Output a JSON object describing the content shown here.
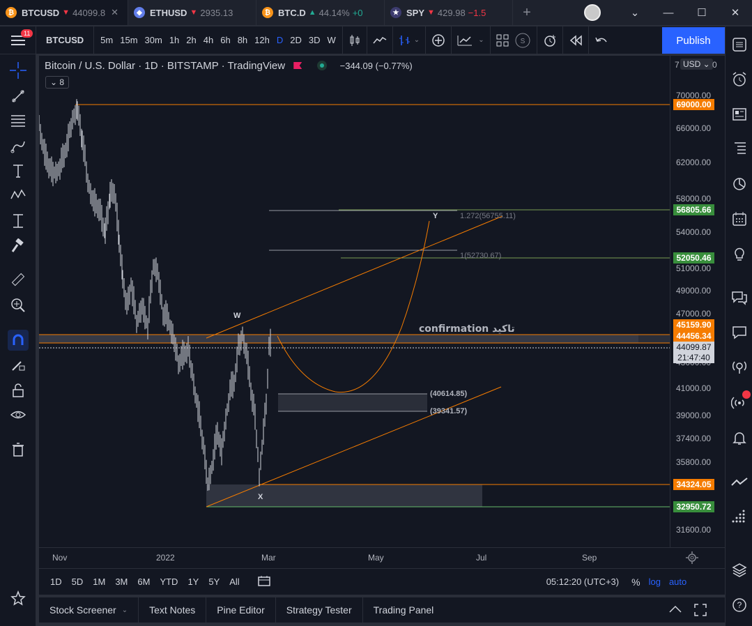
{
  "browser_tabs": [
    {
      "symbol": "BTCUSD",
      "arrow": "▼",
      "price": "44099.8",
      "icon_color": "#f7931a",
      "icon_glyph": "₿",
      "active": true
    },
    {
      "symbol": "ETHUSD",
      "arrow": "▼",
      "price": "2935.13",
      "icon_color": "#627eea",
      "icon_glyph": "◆",
      "active": false
    },
    {
      "symbol": "BTC.D",
      "arrow": "▲",
      "price": "44.14%",
      "extra": "+0",
      "icon_color": "#f7931a",
      "icon_glyph": "₿",
      "active": false
    },
    {
      "symbol": "SPY",
      "arrow": "▼",
      "price": "429.98",
      "extra": "−1.5",
      "icon_color": "#3c3b6e",
      "icon_glyph": "★",
      "active": false
    }
  ],
  "toolbar": {
    "notification_count": "11",
    "symbol": "BTCUSD",
    "intervals": [
      "5m",
      "15m",
      "30m",
      "1h",
      "2h",
      "4h",
      "6h",
      "8h",
      "12h",
      "D",
      "2D",
      "3D",
      "W"
    ],
    "selected_interval": "D",
    "publish_label": "Publish"
  },
  "legend": {
    "title": "Bitcoin / U.S. Dollar · 1D · BITSTAMP · TradingView",
    "change": "−344.09 (−0.77%)",
    "indicator_count": "8"
  },
  "price_scale": {
    "currency": "USD",
    "top_digit": "7",
    "top_digit_2": "0",
    "ticks": [
      "70000.00",
      "66000.00",
      "62000.00",
      "58000.00",
      "54000.00",
      "51000.00",
      "49000.00",
      "47000.00",
      "43000.00",
      "41000.00",
      "39000.00",
      "37400.00",
      "35800.00",
      "31600.00"
    ],
    "tags": [
      {
        "label": "69000.00",
        "color": "#f57c00"
      },
      {
        "label": "56805.66",
        "color": "#388e3c"
      },
      {
        "label": "52050.46",
        "color": "#388e3c"
      },
      {
        "label": "45159.90",
        "color": "#f57c00"
      },
      {
        "label": "44456.34",
        "color": "#f57c00"
      },
      {
        "label": "34324.05",
        "color": "#f57c00"
      },
      {
        "label": "32950.72",
        "color": "#388e3c"
      }
    ],
    "last_price": "44099.87",
    "countdown": "21:47:40"
  },
  "annotations": {
    "w_label": "W",
    "x_label": "X",
    "y_label": "Y",
    "confirmation": "confirmation تاکید",
    "fib_1272": "1.272(56755.11)",
    "fib_1": "1(52730.67)",
    "box_top": "(40614.85)",
    "box_bottom": "(39341.57)"
  },
  "time_axis": [
    "Nov",
    "2022",
    "Mar",
    "May",
    "Jul",
    "Sep"
  ],
  "range_bar": {
    "ranges": [
      "1D",
      "5D",
      "1M",
      "3M",
      "6M",
      "YTD",
      "1Y",
      "5Y",
      "All"
    ],
    "clock": "05:12:20 (UTC+3)",
    "percent": "%",
    "log": "log",
    "auto": "auto"
  },
  "bottom_tabs": [
    "Stock Screener",
    "Text Notes",
    "Pine Editor",
    "Strategy Tester",
    "Trading Panel"
  ],
  "colors": {
    "orange": "#f57c00",
    "green": "#388e3c",
    "accent": "#2962ff",
    "background": "#131722"
  }
}
